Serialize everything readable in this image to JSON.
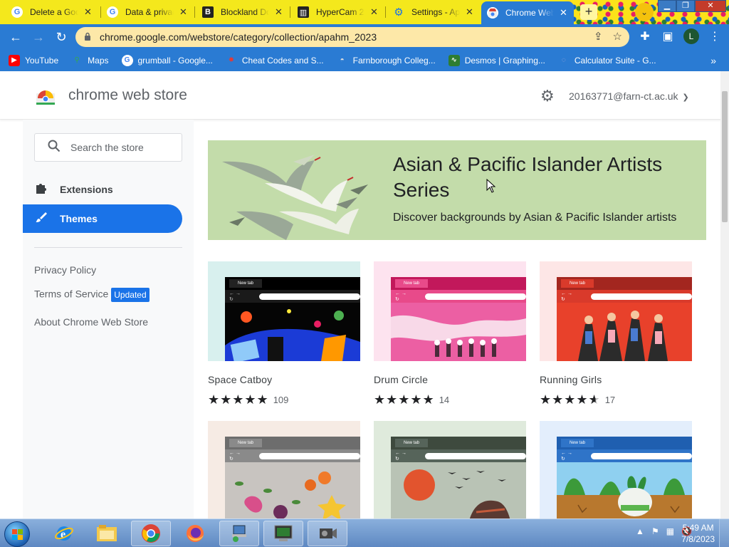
{
  "browser": {
    "tabs": [
      {
        "title": "Delete a Google",
        "icon": "google-icon"
      },
      {
        "title": "Data & privacy",
        "icon": "google-icon"
      },
      {
        "title": "Blockland Downloads",
        "icon": "blockland-icon"
      },
      {
        "title": "HyperCam 2",
        "icon": "museum-icon"
      },
      {
        "title": "Settings - Appearance",
        "icon": "settings-gear-icon"
      },
      {
        "title": "Chrome Web Store",
        "icon": "chrome-web-store-icon",
        "active": true
      }
    ],
    "close_glyph": "✕",
    "url": "chrome.google.com/webstore/category/collection/apahm_2023",
    "profile_initial": "L",
    "bookmarks": [
      {
        "label": "YouTube",
        "icon": "youtube-icon"
      },
      {
        "label": "Maps",
        "icon": "maps-icon"
      },
      {
        "label": "grumball - Google...",
        "icon": "google-icon"
      },
      {
        "label": "Cheat Codes and S...",
        "icon": "cheat-codes-icon"
      },
      {
        "label": "Farnborough Colleg...",
        "icon": "farnborough-icon"
      },
      {
        "label": "Desmos | Graphing...",
        "icon": "desmos-icon"
      },
      {
        "label": "Calculator Suite - G...",
        "icon": "geogebra-icon"
      }
    ]
  },
  "store": {
    "brand": "chrome web store",
    "account": "20163771@farn-ct.ac.uk",
    "search_placeholder": "Search the store",
    "nav": [
      {
        "label": "Extensions",
        "icon": "puzzle-icon",
        "selected": false
      },
      {
        "label": "Themes",
        "icon": "brush-icon",
        "selected": true
      }
    ],
    "footer_links": {
      "privacy": "Privacy Policy",
      "terms": "Terms of Service",
      "terms_badge": "Updated",
      "about": "About Chrome Web Store"
    },
    "banner": {
      "title": "Asian & Pacific Islander Artists Series",
      "subtitle": "Discover backgrounds by Asian & Pacific Islander artists"
    },
    "theme_preview_tab_label": "New tab",
    "themes": [
      {
        "name": "Space Catboy",
        "stars": 5,
        "rating_count": "109"
      },
      {
        "name": "Drum Circle",
        "stars": 5,
        "rating_count": "14"
      },
      {
        "name": "Running Girls",
        "stars": 4.5,
        "rating_count": "17"
      },
      {
        "name": "",
        "stars": null,
        "rating_count": ""
      },
      {
        "name": "",
        "stars": null,
        "rating_count": ""
      },
      {
        "name": "",
        "stars": null,
        "rating_count": ""
      }
    ]
  },
  "taskbar": {
    "time": "5:49 AM",
    "date": "7/8/2023",
    "apps": [
      "internet-explorer-icon",
      "file-explorer-icon",
      "chrome-icon",
      "firefox-icon",
      "network-app-icon",
      "terminal-app-icon",
      "camera-app-icon"
    ]
  },
  "colors": {
    "tabstrip": "#f4e81c",
    "toolbar": "#2a7bd3",
    "accent": "#1a73e8",
    "banner": "#c3dcaa"
  }
}
